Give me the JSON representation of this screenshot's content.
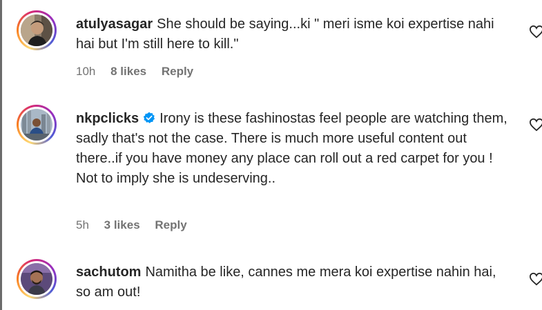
{
  "comments": [
    {
      "username": "atulyasagar",
      "verified": false,
      "text": "She should be saying...ki \" meri isme koi expertise nahi hai but I'm still here to kill.\"",
      "time": "10h",
      "likes": "8 likes",
      "reply": "Reply"
    },
    {
      "username": "nkpclicks",
      "verified": true,
      "text": "Irony is these fashinostas feel people are watching them, sadly that's not the case. There is much more useful content out there..if you have money any place can roll out a red carpet for you ! Not to imply she is undeserving..",
      "time": "5h",
      "likes": "3 likes",
      "reply": "Reply"
    },
    {
      "username": "sachutom",
      "verified": false,
      "text": "Namitha be like, cannes me mera koi expertise nahin hai, so am out!",
      "time": "",
      "likes": "",
      "reply": ""
    }
  ],
  "colors": {
    "text": "#262626",
    "meta": "#737373",
    "verified": "#0095f6"
  },
  "icons": {
    "like": "heart-outline-icon",
    "verified": "verified-badge-icon"
  }
}
